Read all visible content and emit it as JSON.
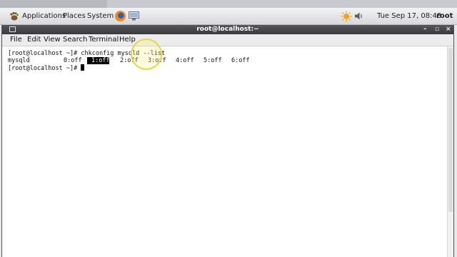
{
  "panel": {
    "menus": [
      "Applications",
      "Places",
      "System"
    ],
    "clock": "Tue Sep 17, 08:48",
    "user": "root",
    "icons": [
      "gnome-foot-icon",
      "firefox-icon",
      "network-icon",
      "weather-icon",
      "volume-icon"
    ]
  },
  "window": {
    "title": "root@localhost:~",
    "controls": [
      "–",
      "▫",
      "×"
    ],
    "menu": [
      "File",
      "Edit",
      "View",
      "Search",
      "Terminal",
      "Help"
    ]
  },
  "terminal": {
    "prompt1": "[root@localhost ~]# ",
    "command": "chkconfig mysqld --list",
    "service": "mysqld",
    "levels": [
      "0:off",
      "1:off",
      "2:off",
      "3:off",
      "4:off",
      "5:off",
      "6:off"
    ],
    "selected_level": "1:off",
    "prompt2": "[root@localhost ~]# "
  },
  "colors": {
    "panel": "#e6e6e9",
    "titlebar": "#434347",
    "selection": "#000000",
    "highlight_ring": "#e7d648"
  }
}
